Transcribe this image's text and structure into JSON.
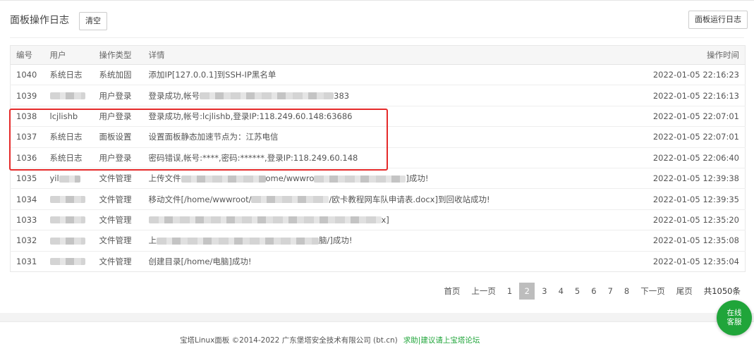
{
  "header": {
    "title": "面板操作日志",
    "clear_label": "清空",
    "runlog_label": "面板运行日志"
  },
  "table": {
    "columns": [
      "编号",
      "用户",
      "操作类型",
      "详情",
      "操作时间"
    ],
    "rows": [
      {
        "id": "1040",
        "user": "系统日志",
        "type": "系统加固",
        "detail": "添加IP[127.0.0.1]到SSH-IP黑名单",
        "time": "2022-01-05 22:16:23"
      },
      {
        "id": "1039",
        "user": "",
        "type": "用户登录",
        "detail": "登录成功,帐号",
        "detail_tail": "383",
        "time": "2022-01-05 22:16:13"
      },
      {
        "id": "1038",
        "user": "lcjlishb",
        "type": "用户登录",
        "detail": "登录成功,帐号:lcjlishb,登录IP:118.249.60.148:63686",
        "time": "2022-01-05 22:07:01"
      },
      {
        "id": "1037",
        "user": "系统日志",
        "type": "面板设置",
        "detail": "设置面板静态加速节点为：江苏电信",
        "time": "2022-01-05 22:07:01"
      },
      {
        "id": "1036",
        "user": "系统日志",
        "type": "用户登录",
        "detail": "密码错误,帐号:****,密码:******,登录IP:118.249.60.148",
        "time": "2022-01-05 22:06:40"
      },
      {
        "id": "1035",
        "user": "yil",
        "type": "文件管理",
        "detail": "上传文件",
        "detail_mid": "ome/wwwro",
        "detail_tail": "]成功!",
        "time": "2022-01-05 12:39:38"
      },
      {
        "id": "1034",
        "user": "",
        "type": "文件管理",
        "detail": "移动文件[/home/wwwroot/",
        "detail_tail": "/欧卡教程网车队申请表.docx]到回收站成功!",
        "time": "2022-01-05 12:39:35"
      },
      {
        "id": "1033",
        "user": "",
        "type": "文件管理",
        "detail": "",
        "detail_tail": "x]",
        "time": "2022-01-05 12:35:20"
      },
      {
        "id": "1032",
        "user": "",
        "type": "文件管理",
        "detail": "上",
        "detail_tail": "脑/]成功!",
        "time": "2022-01-05 12:35:08"
      },
      {
        "id": "1031",
        "user": "",
        "type": "文件管理",
        "detail": "创建目录[/home/电脑]成功!",
        "time": "2022-01-05 12:35:04"
      }
    ]
  },
  "pager": {
    "first": "首页",
    "prev": "上一页",
    "pages": [
      "1",
      "2",
      "3",
      "4",
      "5",
      "6",
      "7",
      "8"
    ],
    "current": "2",
    "next": "下一页",
    "last": "尾页",
    "total": "共1050条"
  },
  "footer": {
    "text": "宝塔Linux面板 ©2014-2022 广东堡塔安全技术有限公司 (bt.cn)",
    "link": "求助|建议请上宝塔论坛"
  },
  "service": {
    "line1": "在线",
    "line2": "客服"
  },
  "colors": {
    "accent": "#20a53a",
    "highlight": "#e52a2a"
  }
}
